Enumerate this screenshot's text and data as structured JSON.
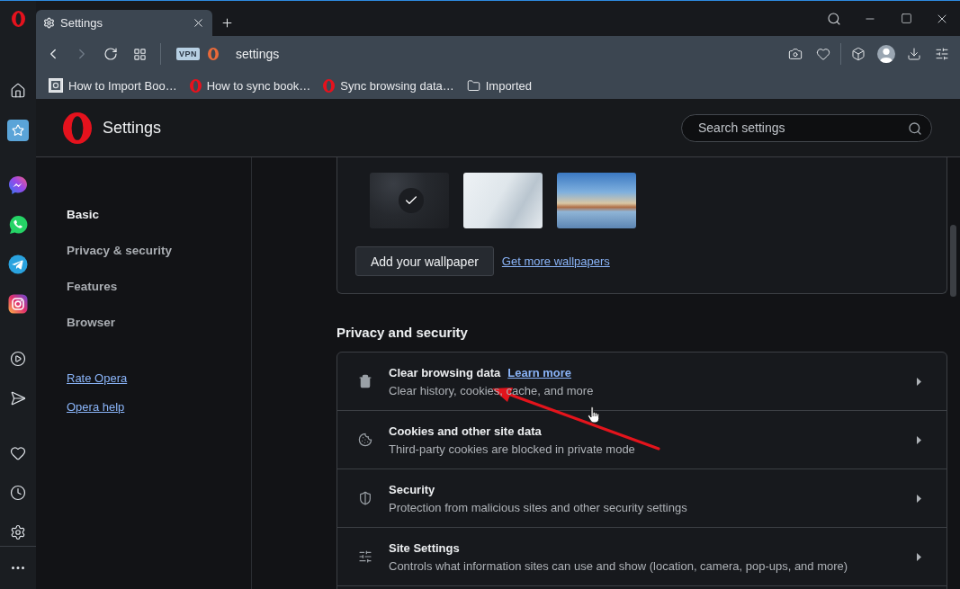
{
  "tabs": [
    {
      "label": "Settings",
      "selected": true
    }
  ],
  "toolbar": {
    "nav_buttons": [
      {
        "kind": "back",
        "disabled": false
      },
      {
        "kind": "forward",
        "disabled": true
      },
      {
        "kind": "reload",
        "disabled": false
      },
      {
        "kind": "grid",
        "disabled": false
      }
    ],
    "badge": "VPN",
    "address": "settings"
  },
  "bookmarks": [
    {
      "kind": "page",
      "label": "How to Import Boo…"
    },
    {
      "kind": "logo",
      "label": "How to sync book…"
    },
    {
      "kind": "logo",
      "label": "Sync browsing data…"
    },
    {
      "kind": "folder",
      "label": "Imported"
    }
  ],
  "sidebar": {
    "groups": [
      {
        "items": [
          {
            "kind": "home",
            "selected": false
          },
          {
            "kind": "speed_dial",
            "selected": true
          }
        ]
      },
      {
        "items": [
          {
            "kind": "chat",
            "selected": false
          },
          {
            "kind": "call",
            "selected": false
          },
          {
            "kind": "plane",
            "selected": false
          },
          {
            "kind": "camera",
            "selected": false
          }
        ]
      },
      {
        "items": [
          {
            "kind": "player",
            "selected": false
          },
          {
            "kind": "send",
            "selected": false
          }
        ]
      },
      {
        "items": [
          {
            "kind": "heart",
            "selected": false
          },
          {
            "kind": "clock",
            "selected": false
          },
          {
            "kind": "gear",
            "selected": false
          }
        ]
      }
    ],
    "bottom_items": [
      {
        "kind": "more",
        "selected": false
      }
    ]
  },
  "header": {
    "title": "Settings",
    "search": {
      "placeholder": "Search settings"
    }
  },
  "nav": {
    "items": [
      {
        "label": "Basic",
        "selected": true
      },
      {
        "label": "Privacy & security",
        "selected": false
      },
      {
        "label": "Features",
        "selected": false
      },
      {
        "label": "Browser",
        "selected": false
      }
    ],
    "links": [
      "Rate Opera",
      "Opera help"
    ]
  },
  "wallpapers": {
    "items": [
      {
        "kind": "dark",
        "selected": true
      },
      {
        "kind": "light",
        "selected": false
      },
      {
        "kind": "landscape",
        "selected": false
      }
    ],
    "add_button": "Add your wallpaper",
    "more_link": "Get more wallpapers"
  },
  "privacy": {
    "heading": "Privacy and security",
    "rows": [
      {
        "kind": "trash",
        "title": "Clear browsing data",
        "link": "Learn more",
        "description": "Clear history, cookies, cache, and more"
      },
      {
        "kind": "cookie",
        "title": "Cookies and other site data",
        "description": "Third-party cookies are blocked in private mode"
      },
      {
        "kind": "shield",
        "title": "Security",
        "description": "Protection from malicious sites and other security settings"
      },
      {
        "kind": "sliders",
        "title": "Site Settings",
        "description": "Controls what information sites can use and show (location, camera, pop-ups, and more)"
      }
    ]
  }
}
